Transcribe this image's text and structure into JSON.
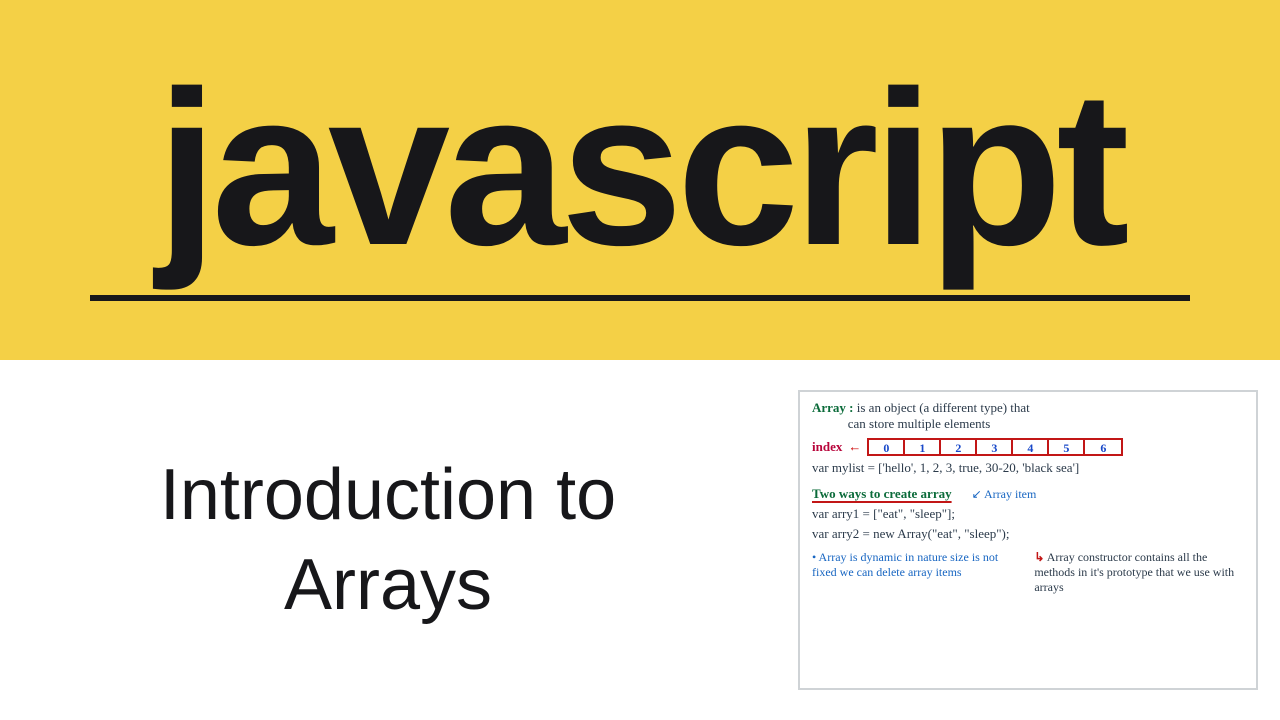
{
  "banner": {
    "title": "javascript"
  },
  "subtitle": {
    "line1": "Introduction to",
    "line2": "Arrays"
  },
  "notes": {
    "definition": {
      "label": "Array :",
      "text1": "is an object (a different type) that",
      "text2": "can store multiple elements"
    },
    "index": {
      "label": "index",
      "values": [
        "0",
        "1",
        "2",
        "3",
        "4",
        "5",
        "6"
      ]
    },
    "mylist": "var mylist = ['hello', 1, 2, 3, true, 30-20, 'black sea']",
    "twoWaysHeading": "Two ways to create array",
    "arrayItemAnnot": "Array item",
    "arry1": "var arry1 = [\"eat\", \"sleep\"];",
    "arry2": "var arry2 = new Array(\"eat\", \"sleep\");",
    "footLeft": "Array is dynamic in nature size is not fixed we can delete array items",
    "footRight": "Array constructor contains all the methods in it's prototype that we use with arrays"
  }
}
